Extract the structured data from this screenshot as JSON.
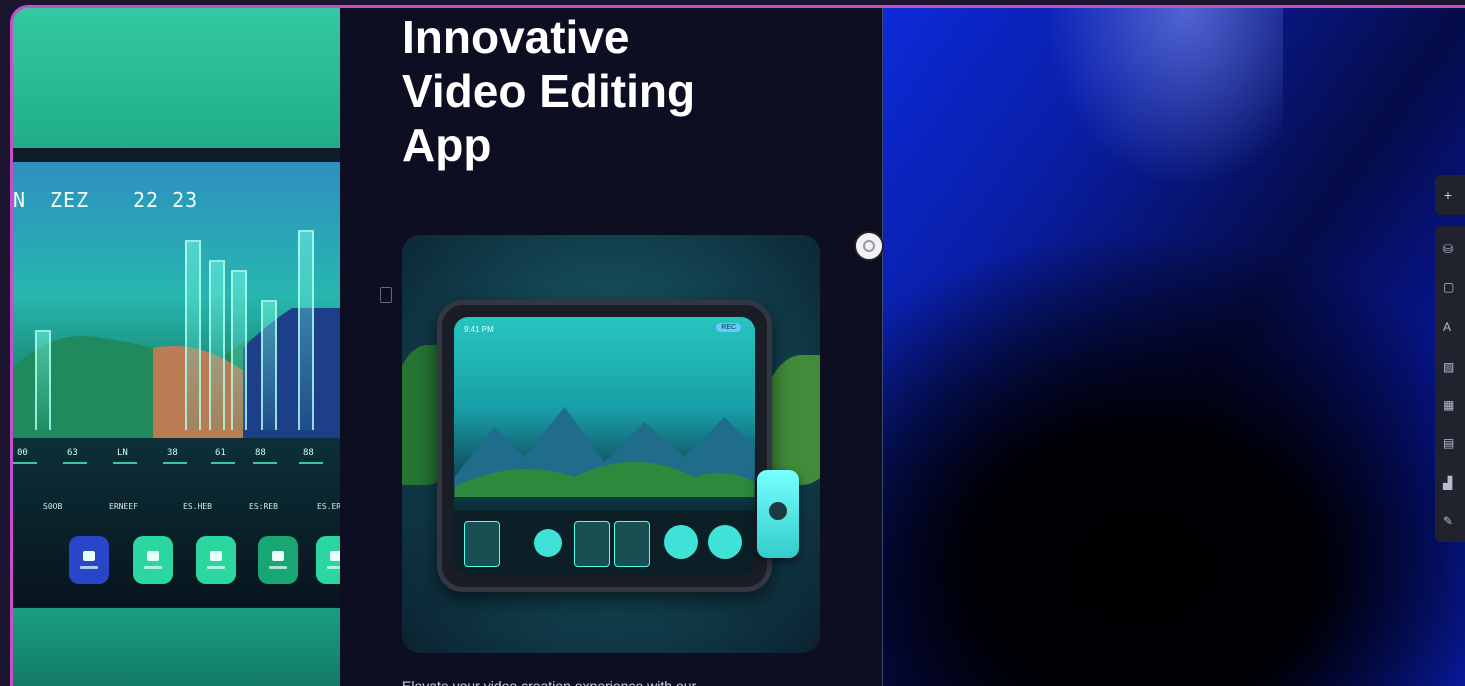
{
  "headline": {
    "line1": "Innovative",
    "line2": "Video Editing",
    "line3": "App"
  },
  "description": "Elevate your video creation experience with our",
  "preview_left": {
    "timestamps": [
      "N",
      "ZEZ",
      "22 23"
    ],
    "tick_labels": [
      "00",
      "63",
      "LN",
      "38",
      "61",
      "88",
      "88"
    ],
    "row_words": [
      "S0OB",
      "ERNEEF",
      "ES.HEB",
      "ES:REB",
      "ES.ER"
    ]
  },
  "tablet": {
    "status_left": "9:41 PM",
    "status_badge": "REC"
  },
  "toolbar": {
    "top_icon": "plus-icon",
    "items": [
      {
        "icon": "stack-icon",
        "glyph": "⛁"
      },
      {
        "icon": "square-icon",
        "glyph": "▢"
      },
      {
        "icon": "text-icon",
        "glyph": "A"
      },
      {
        "icon": "image-icon",
        "glyph": "▨"
      },
      {
        "icon": "grid-icon",
        "glyph": "▦"
      },
      {
        "icon": "layout-icon",
        "glyph": "▤"
      },
      {
        "icon": "chart-icon",
        "glyph": "▟"
      },
      {
        "icon": "pen-icon",
        "glyph": "✎"
      }
    ]
  },
  "colors": {
    "frame_border": "#c54fc8",
    "accent_teal": "#2bd6a0",
    "panel_dark": "#0d0e22",
    "gradient_blue": "#0c2ad8"
  }
}
